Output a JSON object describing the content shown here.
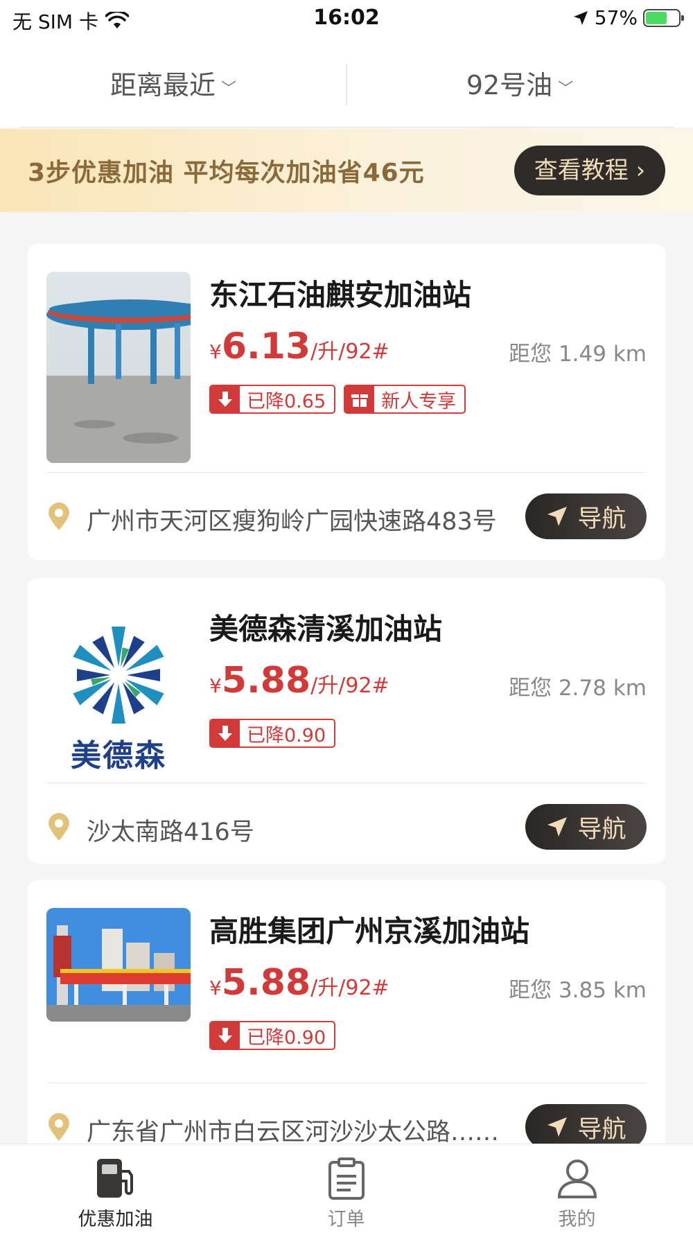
{
  "status_bar": {
    "carrier": "无 SIM 卡",
    "time": "16:02",
    "battery": "57%"
  },
  "filters": {
    "sort_label": "距离最近",
    "fuel_label": "92号油"
  },
  "banner": {
    "text": "3步优惠加油  平均每次加油省46元",
    "button_label": "查看教程"
  },
  "stations": [
    {
      "name": "东江石油麒安加油站",
      "currency": "¥",
      "price": "6.13",
      "unit": "/升/92#",
      "distance": "距您 1.49 km",
      "tag_discount": "已降0.65",
      "tag_new": "新人专享",
      "address": "广州市天河区瘦狗岭广园快速路483号",
      "nav_label": "导航"
    },
    {
      "name": "美德森清溪加油站",
      "currency": "¥",
      "price": "5.88",
      "unit": "/升/92#",
      "distance": "距您 2.78 km",
      "tag_discount": "已降0.90",
      "logo_text": "美德森",
      "address": "沙太南路416号",
      "nav_label": "导航"
    },
    {
      "name": "高胜集团广州京溪加油站",
      "currency": "¥",
      "price": "5.88",
      "unit": "/升/92#",
      "distance": "距您 3.85 km",
      "tag_discount": "已降0.90",
      "address": "广东省广州市白云区河沙沙太公路……",
      "nav_label": "导航"
    }
  ],
  "tabbar": [
    {
      "label": "优惠加油",
      "icon": "fuel-pump-icon",
      "active": true
    },
    {
      "label": "订单",
      "icon": "clipboard-icon",
      "active": false
    },
    {
      "label": "我的",
      "icon": "user-icon",
      "active": false
    }
  ],
  "colors": {
    "price_red": "#d23a3a",
    "gold": "#e0c07a",
    "dark_button": "#2f2b28"
  }
}
